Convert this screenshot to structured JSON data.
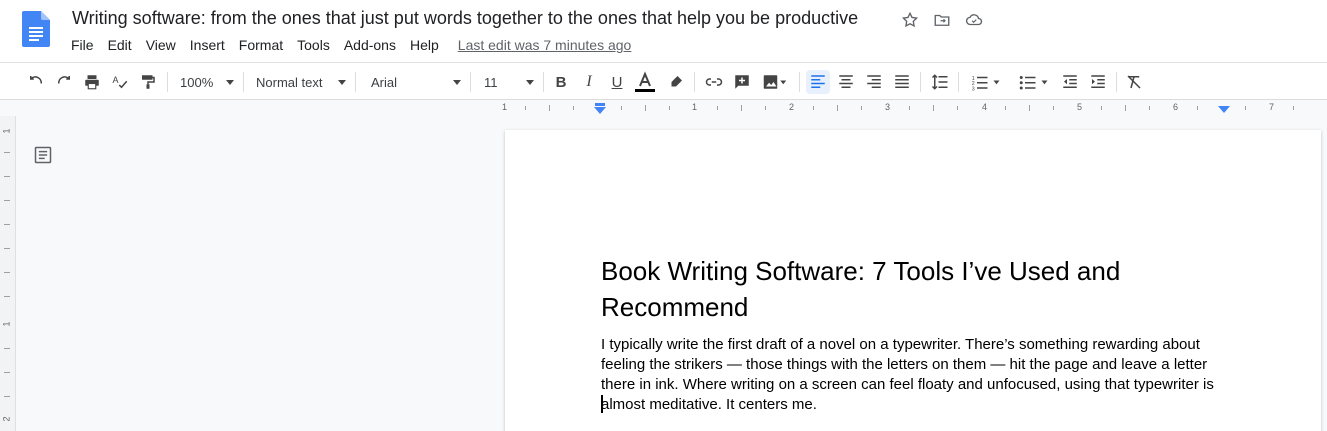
{
  "app": {
    "doc_title": "Writing software: from the ones that just put words together to the ones that help you be productive",
    "menu": [
      "File",
      "Edit",
      "View",
      "Insert",
      "Format",
      "Tools",
      "Add-ons",
      "Help"
    ],
    "last_edit": "Last edit was 7 minutes ago"
  },
  "toolbar": {
    "zoom": "100%",
    "style": "Normal text",
    "font": "Arial",
    "font_size": "11"
  },
  "ruler": {
    "numbers": [
      "1",
      "1",
      "2",
      "3",
      "4",
      "5",
      "6",
      "7"
    ]
  },
  "vruler": {
    "numbers": [
      "1",
      "1",
      "2"
    ]
  },
  "document": {
    "heading": "Book Writing Software: 7 Tools I’ve Used and Recommend",
    "body": "I typically write the first draft of a novel on a typewriter. There’s something rewarding about feeling the strikers — those things with the letters on them — hit the page and leave a letter there in ink. Where writing on a screen can feel floaty and unfocused, using that typewriter is almost meditative. It centers me."
  },
  "colors": {
    "accent": "#1a73e8",
    "docs_blue": "#4285f4",
    "text": "#202124"
  }
}
